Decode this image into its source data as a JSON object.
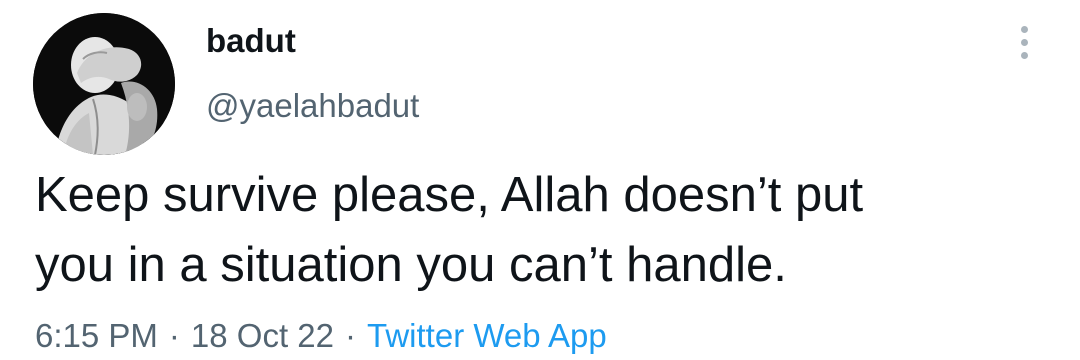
{
  "user": {
    "display_name": "badut",
    "handle": "@yaelahbadut",
    "avatar": "avatar-image"
  },
  "tweet": {
    "text_line_1": "Keep survive please, Allah doesn’t put",
    "text_line_2": "you in a situation you can’t handle.",
    "time": "6:15 PM",
    "separator_1": "·",
    "date": "18 Oct 22",
    "separator_2": "·",
    "source": "Twitter Web App"
  },
  "icons": {
    "more": "more-vertical-icon"
  },
  "colors": {
    "text_primary": "#0f1419",
    "text_secondary": "#536471",
    "link": "#1d9bf0",
    "background": "#ffffff",
    "more_icon": "#aab4bc"
  }
}
